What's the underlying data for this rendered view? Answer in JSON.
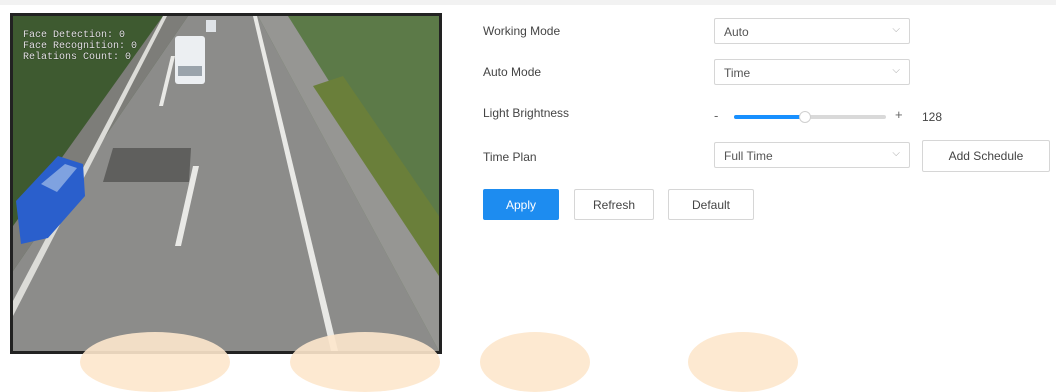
{
  "preview": {
    "osd_lines": [
      "Face Detection: 0",
      "Face Recognition: 0",
      "Relations Count: 0"
    ]
  },
  "form": {
    "working_mode": {
      "label": "Working Mode",
      "value": "Auto"
    },
    "auto_mode": {
      "label": "Auto Mode",
      "value": "Time"
    },
    "light_brightness": {
      "label": "Light Brightness",
      "minus": "-",
      "plus": "+",
      "value": "128",
      "fraction": 0.47
    },
    "time_plan": {
      "label": "Time Plan",
      "value": "Full Time",
      "add_schedule_label": "Add Schedule"
    }
  },
  "buttons": {
    "apply": "Apply",
    "refresh": "Refresh",
    "default": "Default"
  },
  "colors": {
    "accent": "#1d8cf0",
    "watermark": "#fde7cc"
  },
  "icons": {
    "select_chevron": "chevron-down-icon"
  }
}
